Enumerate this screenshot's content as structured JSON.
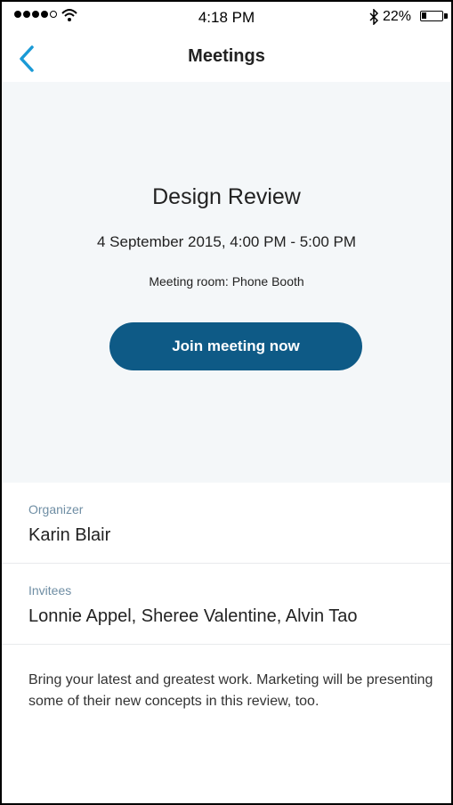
{
  "status_bar": {
    "time": "4:18 PM",
    "battery_percent": "22%",
    "battery_level": 0.22,
    "signal_bars_filled": 4,
    "signal_bars_total": 5,
    "icons": [
      "signal-dots-icon",
      "wifi-icon",
      "bluetooth-icon",
      "battery-icon"
    ]
  },
  "nav": {
    "title": "Meetings",
    "back_icon": "chevron-left-icon",
    "accent_color": "#1a9ad6"
  },
  "meeting": {
    "title": "Design Review",
    "time": "4 September 2015, 4:00 PM - 5:00 PM",
    "room": "Meeting room: Phone Booth",
    "join_label": "Join meeting now",
    "join_color": "#0e5a86"
  },
  "organizer": {
    "label": "Organizer",
    "value": "Karin Blair"
  },
  "invitees": {
    "label": "Invitees",
    "value": "Lonnie Appel, Sheree Valentine, Alvin Tao"
  },
  "description": "Bring your latest and greatest work. Marketing will be presenting some of their new concepts in this review, too."
}
